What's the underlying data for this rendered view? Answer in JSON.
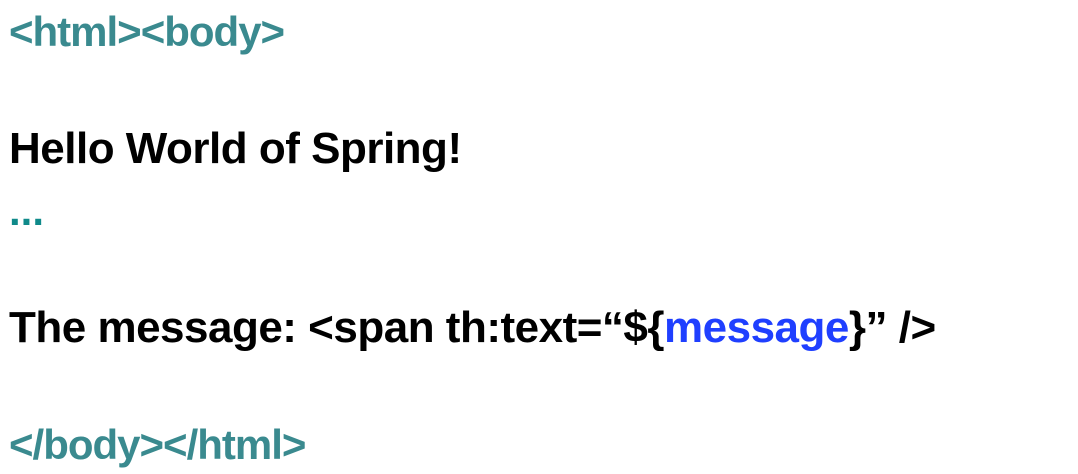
{
  "colors": {
    "tag_teal": "#3a8a8f",
    "ellipsis_teal": "#0f8a8a",
    "text_black": "#000000",
    "variable_blue": "#1f3fff",
    "background": "#ffffff"
  },
  "code": {
    "open_tags": "<html><body>",
    "hello_line": "Hello World of Spring!",
    "ellipsis": "...",
    "message_prefix": "The message: <span th:text=“${",
    "message_variable": "message",
    "message_suffix": "}” />",
    "close_tags": "</body></html>"
  }
}
